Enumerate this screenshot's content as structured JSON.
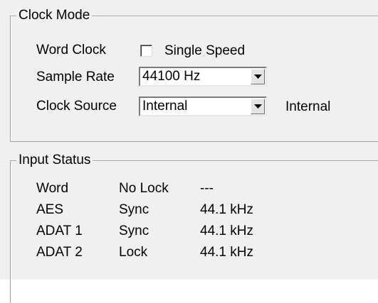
{
  "clock_mode": {
    "title": "Clock Mode",
    "word_clock": {
      "label": "Word Clock",
      "checkbox_label": "Single Speed",
      "checked": false
    },
    "sample_rate": {
      "label": "Sample Rate",
      "value": "44100 Hz"
    },
    "clock_source": {
      "label": "Clock Source",
      "value": "Internal",
      "status": "Internal"
    }
  },
  "input_status": {
    "title": "Input Status",
    "rows": [
      {
        "name": "Word",
        "state": "No Lock",
        "rate": "---"
      },
      {
        "name": "AES",
        "state": "Sync",
        "rate": "44.1 kHz"
      },
      {
        "name": "ADAT 1",
        "state": "Sync",
        "rate": "44.1 kHz"
      },
      {
        "name": "ADAT 2",
        "state": "Lock",
        "rate": "44.1 kHz"
      }
    ]
  },
  "icons": {
    "dropdown": "chevron-down-icon"
  }
}
